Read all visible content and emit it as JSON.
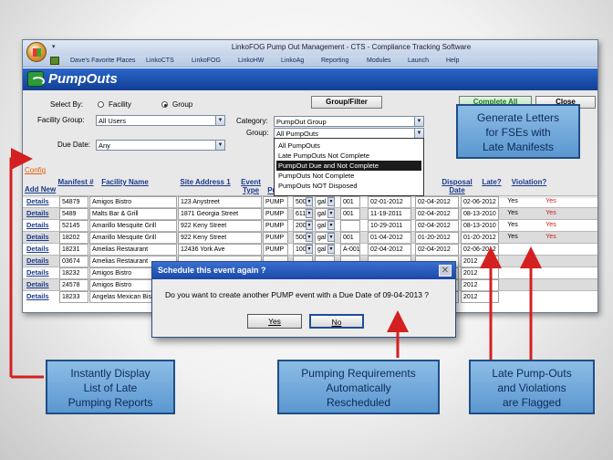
{
  "app": {
    "window_title": "LinkoFOG Pump Out Management - CTS - Compliance Tracking Software",
    "menu": [
      "Dave's Favorite Places",
      "LinkoCTS",
      "LinkoFOG",
      "LinkoHW",
      "LinkoAg",
      "Reporting",
      "Modules",
      "Launch",
      "Help"
    ],
    "page_title": "PumpOuts"
  },
  "filters": {
    "select_by_label": "Select By:",
    "radio_facility": "Facility",
    "radio_group": "Group",
    "facility_group_label": "Facility Group:",
    "facility_group_value": "All Users",
    "due_date_label": "Due Date:",
    "due_date_value": "Any",
    "group_filter_button": "Group/Filter",
    "category_label": "Category:",
    "category_value": "PumpOut Group",
    "group_label": "Group:",
    "group_value": "All PumpOuts",
    "group_options": [
      "All PumpOuts",
      "Late PumpOuts Not Complete",
      "PumpOut Due and Not Complete",
      "PumpOuts Not Complete",
      "PumpOuts NOT Disposed"
    ],
    "group_selected_option": "PumpOut Due and Not Complete",
    "complete_all_button": "Complete All",
    "close_button": "Close"
  },
  "grid": {
    "config_link": "Config",
    "add_new_link": "Add New",
    "headers": [
      "Manifest #",
      "Facility Name",
      "Site Address 1",
      "Event Type",
      "Pumped",
      "Disposal Date",
      "Late?",
      "Violation?"
    ],
    "details_label": "Details",
    "rows": [
      {
        "manifest": "54879",
        "facility": "Amigos Bistro",
        "address": "123 Anystreet",
        "type": "PUMP",
        "qty": "500",
        "unit": "gal",
        "ref": "001",
        "d1": "02-01-2012",
        "d2": "02-04-2012",
        "disposal": "02-06-2012",
        "late": "Yes",
        "violation": "Yes"
      },
      {
        "manifest": "5489",
        "facility": "Malts Bar & Grill",
        "address": "1871 Georgia Street",
        "type": "PUMP",
        "qty": "611",
        "unit": "gal",
        "ref": "001",
        "d1": "11-19-2011",
        "d2": "02-04-2012",
        "disposal": "08-13-2010",
        "late": "Yes",
        "violation": "Yes"
      },
      {
        "manifest": "52145",
        "facility": "Amarillo Mesquite Grill",
        "address": "922 Keny Street",
        "type": "PUMP",
        "qty": "200",
        "unit": "gal",
        "ref": "",
        "d1": "10-29-2011",
        "d2": "02-04-2012",
        "disposal": "08-13-2010",
        "late": "Yes",
        "violation": "Yes"
      },
      {
        "manifest": "18202",
        "facility": "Amarillo Mesquite Grill",
        "address": "922 Keny Street",
        "type": "PUMP",
        "qty": "500",
        "unit": "gal",
        "ref": "001",
        "d1": "01-04-2012",
        "d2": "01-20-2012",
        "disposal": "01-20-2012",
        "late": "Yes",
        "violation": "Yes"
      },
      {
        "manifest": "18231",
        "facility": "Amelias Restaurant",
        "address": "12436 York Ave",
        "type": "PUMP",
        "qty": "100",
        "unit": "gal",
        "ref": "A-001",
        "d1": "02-04-2012",
        "d2": "02-04-2012",
        "disposal": "02-06-2012",
        "late": "",
        "violation": ""
      },
      {
        "manifest": "03674",
        "facility": "Amelias Restaurant",
        "address": "",
        "type": "",
        "qty": "",
        "unit": "",
        "ref": "",
        "d1": "",
        "d2": "",
        "disposal": "2012",
        "late": "",
        "violation": ""
      },
      {
        "manifest": "18232",
        "facility": "Amigos Bistro",
        "address": "",
        "type": "",
        "qty": "",
        "unit": "",
        "ref": "",
        "d1": "",
        "d2": "",
        "disposal": "2012",
        "late": "",
        "violation": ""
      },
      {
        "manifest": "24578",
        "facility": "Amigos Bistro",
        "address": "",
        "type": "",
        "qty": "",
        "unit": "",
        "ref": "",
        "d1": "",
        "d2": "",
        "disposal": "2012",
        "late": "",
        "violation": ""
      },
      {
        "manifest": "18233",
        "facility": "Angelas Mexican Bistro #1",
        "address": "",
        "type": "",
        "qty": "",
        "unit": "",
        "ref": "",
        "d1": "",
        "d2": "",
        "disposal": "2012",
        "late": "",
        "violation": ""
      }
    ]
  },
  "dialog": {
    "title": "Schedule this event again ?",
    "message": "Do you want to create another PUMP event with a Due Date of 09-04-2013 ?",
    "yes": "Yes",
    "no": "No"
  },
  "callouts": {
    "generate_letters": [
      "Generate Letters",
      "for FSEs with",
      "Late Manifests"
    ],
    "instantly_display": [
      "Instantly Display",
      "List of Late",
      "Pumping Reports"
    ],
    "pumping_requirements": [
      "Pumping Requirements",
      "Automatically",
      "Rescheduled"
    ],
    "late_pumpouts": [
      "Late Pump-Outs",
      "and Violations",
      "are Flagged"
    ]
  },
  "colors": {
    "header_blue": "#1a4fb0",
    "callout_fill": "#7fb2e2",
    "arrow_red": "#d42020",
    "violation_red": "#d01818"
  }
}
